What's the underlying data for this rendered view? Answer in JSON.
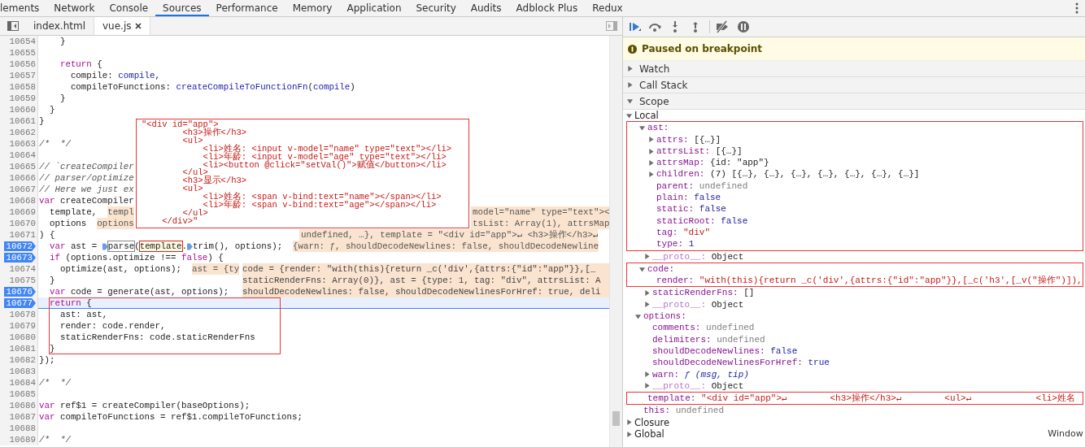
{
  "tabs": [
    {
      "label": "lements",
      "selected": false
    },
    {
      "label": "Network",
      "selected": false
    },
    {
      "label": "Console",
      "selected": false
    },
    {
      "label": "Sources",
      "selected": true
    },
    {
      "label": "Performance",
      "selected": false
    },
    {
      "label": "Memory",
      "selected": false
    },
    {
      "label": "Application",
      "selected": false
    },
    {
      "label": "Security",
      "selected": false
    },
    {
      "label": "Audits",
      "selected": false
    },
    {
      "label": "Adblock Plus",
      "selected": false
    },
    {
      "label": "Redux",
      "selected": false
    }
  ],
  "editor": {
    "files": [
      {
        "label": "index.html",
        "selected": false,
        "closable": false
      },
      {
        "label": "vue.js",
        "selected": true,
        "closable": true
      }
    ],
    "lines": [
      {
        "n": "10654",
        "breakpoint": false,
        "current": false,
        "text": "    }"
      },
      {
        "n": "10655",
        "breakpoint": false,
        "current": false
      },
      {
        "n": "10656",
        "breakpoint": false,
        "current": false,
        "parts": [
          {
            "kind": "kw",
            "t": "    return"
          },
          {
            "kind": "p",
            "t": " {"
          }
        ]
      },
      {
        "n": "10657",
        "breakpoint": false,
        "current": false,
        "parts": [
          {
            "kind": "p",
            "t": "      compile: "
          },
          {
            "kind": "id",
            "t": "compile"
          },
          {
            "kind": "p",
            "t": ","
          }
        ]
      },
      {
        "n": "10658",
        "breakpoint": false,
        "current": false,
        "parts": [
          {
            "kind": "p",
            "t": "      compileToFunctions: "
          },
          {
            "kind": "id",
            "t": "createCompileToFunctionFn"
          },
          {
            "kind": "p",
            "t": "("
          },
          {
            "kind": "id",
            "t": "compile"
          },
          {
            "kind": "p",
            "t": ")"
          }
        ]
      },
      {
        "n": "10659",
        "breakpoint": false,
        "current": false,
        "text": "    }"
      },
      {
        "n": "10660",
        "breakpoint": false,
        "current": false,
        "text": "  }"
      },
      {
        "n": "10661",
        "breakpoint": false,
        "current": false,
        "text": "}"
      },
      {
        "n": "10662",
        "breakpoint": false,
        "current": false
      },
      {
        "n": "10663",
        "breakpoint": false,
        "current": false,
        "parts": [
          {
            "kind": "cm",
            "t": "/*  */"
          }
        ]
      },
      {
        "n": "10664",
        "breakpoint": false,
        "current": false
      },
      {
        "n": "10665",
        "breakpoint": false,
        "current": false,
        "parts": [
          {
            "kind": "cm",
            "t": "// `createCompiler"
          }
        ]
      },
      {
        "n": "10666",
        "breakpoint": false,
        "current": false,
        "parts": [
          {
            "kind": "cm",
            "t": "// parser/optimize"
          }
        ]
      },
      {
        "n": "10667",
        "breakpoint": false,
        "current": false,
        "parts": [
          {
            "kind": "cm",
            "t": "// Here we just ex"
          }
        ]
      },
      {
        "n": "10668",
        "breakpoint": false,
        "current": false,
        "parts": [
          {
            "kind": "kw",
            "t": "var"
          },
          {
            "kind": "p",
            "t": " createCompiler"
          }
        ]
      },
      {
        "n": "10669",
        "breakpoint": false,
        "current": false,
        "parts": [
          {
            "kind": "p",
            "t": "  template,  "
          },
          {
            "kind": "val",
            "t": "templ"
          }
        ],
        "tail": "model=\"name\" type=\"text\"><",
        "covered": true
      },
      {
        "n": "10670",
        "breakpoint": false,
        "current": false,
        "parts": [
          {
            "kind": "p",
            "t": "  options  "
          },
          {
            "kind": "val",
            "t": "options"
          }
        ],
        "tail": "tsList: Array(1), attrsMap",
        "covered": true
      },
      {
        "n": "10671",
        "breakpoint": false,
        "current": false,
        "text": ") {",
        "tail": "undefined, …}, template = \"<div id=\"app\">↵ <h3>操作</h3>↵",
        "covered": false
      },
      {
        "n": "10672",
        "breakpoint": true,
        "current": false,
        "parts": [
          {
            "kind": "kw",
            "t": "  var"
          },
          {
            "kind": "p",
            "t": " ast = "
          },
          {
            "kind": "stop"
          },
          {
            "kind": "frame",
            "t": "parse"
          },
          {
            "kind": "p",
            "t": "("
          },
          {
            "kind": "mark",
            "t": "template"
          },
          {
            "kind": "p",
            "t": "."
          },
          {
            "kind": "stop"
          },
          {
            "kind": "p",
            "t": "trim(), options);  "
          },
          {
            "kind": "val",
            "t": "{warn: ƒ, shouldDecodeNewlines: false, shouldDecodeNewline"
          }
        ]
      },
      {
        "n": "10673",
        "breakpoint": true,
        "current": false,
        "parts": [
          {
            "kind": "kw",
            "t": "  if"
          },
          {
            "kind": "p",
            "t": " (options.optimize !== "
          },
          {
            "kind": "kw",
            "t": "false"
          },
          {
            "kind": "p",
            "t": ") {"
          }
        ]
      },
      {
        "n": "10674",
        "breakpoint": false,
        "current": false,
        "parts": [
          {
            "kind": "p",
            "t": "    optimize(ast, options);  "
          },
          {
            "kind": "val",
            "t": "ast = {ty"
          }
        ],
        "overlay": [
          "code = {render: \"with(this){return _c('div',{attrs:{\"id\":\"app\"}},[_",
          "staticRenderFns: Array(0)}, ast = {type: 1, tag: \"div\", attrsList: A",
          "shouldDecodeNewlines: false, shouldDecodeNewlinesForHref: true, deli"
        ]
      },
      {
        "n": "10675",
        "breakpoint": false,
        "current": false,
        "text": "  }"
      },
      {
        "n": "10676",
        "breakpoint": true,
        "current": false,
        "parts": [
          {
            "kind": "kw",
            "t": "  var"
          },
          {
            "kind": "p",
            "t": " code = generate(ast, options);"
          }
        ]
      },
      {
        "n": "10677",
        "breakpoint": true,
        "current": true,
        "boxed": true,
        "parts": [
          {
            "kind": "kw",
            "t": "  return"
          },
          {
            "kind": "p",
            "t": " {"
          }
        ]
      },
      {
        "n": "10678",
        "breakpoint": false,
        "current": false,
        "boxed": true,
        "text": "    ast: ast,"
      },
      {
        "n": "10679",
        "breakpoint": false,
        "current": false,
        "boxed": true,
        "text": "    render: code.render,"
      },
      {
        "n": "10680",
        "breakpoint": false,
        "current": false,
        "boxed": true,
        "text": "    staticRenderFns: code.staticRenderFns"
      },
      {
        "n": "10681",
        "breakpoint": false,
        "current": false,
        "boxed": true,
        "text": "  }"
      },
      {
        "n": "10682",
        "breakpoint": false,
        "current": false,
        "text": "});"
      },
      {
        "n": "10683",
        "breakpoint": false,
        "current": false
      },
      {
        "n": "10684",
        "breakpoint": false,
        "current": false,
        "parts": [
          {
            "kind": "cm",
            "t": "/*  */"
          }
        ]
      },
      {
        "n": "10685",
        "breakpoint": false,
        "current": false
      },
      {
        "n": "10686",
        "breakpoint": false,
        "current": false,
        "parts": [
          {
            "kind": "kw",
            "t": "var"
          },
          {
            "kind": "p",
            "t": " ref$1 = createCompiler(baseOptions);"
          }
        ]
      },
      {
        "n": "10687",
        "breakpoint": false,
        "current": false,
        "parts": [
          {
            "kind": "kw",
            "t": "var"
          },
          {
            "kind": "p",
            "t": " compileToFunctions = ref$1.compileToFunctions;"
          }
        ]
      },
      {
        "n": "10688",
        "breakpoint": false,
        "current": false
      },
      {
        "n": "10689",
        "breakpoint": false,
        "current": false,
        "parts": [
          {
            "kind": "cm",
            "t": "/*  */"
          }
        ]
      }
    ],
    "popover": [
      "\"<div id=\"app\">",
      "        <h3>操作</h3>",
      "        <ul>",
      "            <li>姓名: <input v-model=\"name\" type=\"text\"></li>",
      "            <li>年龄: <input v-model=\"age\" type=\"text\"></li>",
      "            <li><button @click=\"setVal()\">赋值</button></li>",
      "        </ul>",
      "        <h3>显示</h3>",
      "        <ul>",
      "            <li>姓名: <span v-bind:text=\"name\"></span></li>",
      "            <li>年龄: <span v-bind:text=\"age\"></span></li>",
      "        </ul>",
      "    </div>\""
    ]
  },
  "debugger": {
    "toolbar": [
      {
        "kind": "resume"
      },
      {
        "kind": "step-over"
      },
      {
        "kind": "step-into"
      },
      {
        "kind": "step-out"
      },
      {
        "kind": "deactivate"
      },
      {
        "kind": "pause-exceptions"
      }
    ],
    "banner": "Paused on breakpoint",
    "sections": [
      {
        "label": "Watch",
        "expanded": false
      },
      {
        "label": "Call Stack",
        "expanded": false
      },
      {
        "label": "Scope",
        "expanded": true
      }
    ],
    "scopes": [
      {
        "key": "Local",
        "kind": "scope",
        "expanded": true,
        "children": [
          {
            "key": "ast:",
            "kind": "group",
            "expanded": true,
            "boxed": true,
            "children": [
              {
                "key": "attrs:",
                "value": "[{…}]",
                "kind": "object",
                "expanded": false,
                "boxed": true
              },
              {
                "key": "attrsList:",
                "value": "[{…}]",
                "kind": "object",
                "expanded": false,
                "boxed": true
              },
              {
                "key": "attrsMap:",
                "value": "{id: \"app\"}",
                "kind": "object",
                "expanded": false,
                "boxed": true
              },
              {
                "key": "children:",
                "value": "(7) [{…}, {…}, {…}, {…}, {…}, {…}, {…}]",
                "kind": "object",
                "expanded": false,
                "boxed": true
              },
              {
                "key": "parent:",
                "value": "undefined",
                "kind": "undefined",
                "boxed": true
              },
              {
                "key": "plain:",
                "value": "false",
                "kind": "literal",
                "boxed": true
              },
              {
                "key": "static:",
                "value": "false",
                "kind": "literal",
                "boxed": true
              },
              {
                "key": "staticRoot:",
                "value": "false",
                "kind": "literal",
                "boxed": true
              },
              {
                "key": "tag:",
                "value": "\"div\"",
                "kind": "string",
                "boxed": true
              },
              {
                "key": "type:",
                "value": "1",
                "kind": "literal",
                "boxed": true
              },
              {
                "key": "__proto__:",
                "value": "Object",
                "kind": "proto",
                "expanded": false
              }
            ]
          },
          {
            "key": "code:",
            "kind": "group",
            "expanded": true,
            "boxed": true,
            "children": [
              {
                "key": "render:",
                "value": "\"with(this){return _c('div',{attrs:{\"id\":\"app\"}},[_c('h3',[_v(\"操作\")]),",
                "kind": "string",
                "boxed": true
              },
              {
                "key": "staticRenderFns:",
                "value": "[]",
                "kind": "object",
                "expanded": false
              },
              {
                "key": "__proto__:",
                "value": "Object",
                "kind": "proto",
                "expanded": false
              }
            ]
          },
          {
            "key": "options:",
            "kind": "group",
            "expanded": true,
            "children": [
              {
                "key": "comments:",
                "value": "undefined",
                "kind": "undefined"
              },
              {
                "key": "delimiters:",
                "value": "undefined",
                "kind": "undefined"
              },
              {
                "key": "shouldDecodeNewlines:",
                "value": "false",
                "kind": "literal"
              },
              {
                "key": "shouldDecodeNewlinesForHref:",
                "value": "true",
                "kind": "literal"
              },
              {
                "key": "warn:",
                "value": "ƒ (msg, tip)",
                "kind": "function",
                "expanded": false
              },
              {
                "key": "__proto__:",
                "value": "Object",
                "kind": "proto",
                "expanded": false
              }
            ]
          },
          {
            "key": "template:",
            "value": "\"<div id=\"app\">↵        <h3>操作</h3>↵        <ul>↵            <li>姓名",
            "kind": "string",
            "boxed": true
          },
          {
            "key": "this:",
            "value": "undefined",
            "kind": "undefined"
          }
        ]
      },
      {
        "key": "Closure",
        "kind": "scope",
        "expanded": false
      },
      {
        "key": "Global",
        "kind": "scope",
        "expanded": false,
        "value": "Window"
      }
    ]
  }
}
